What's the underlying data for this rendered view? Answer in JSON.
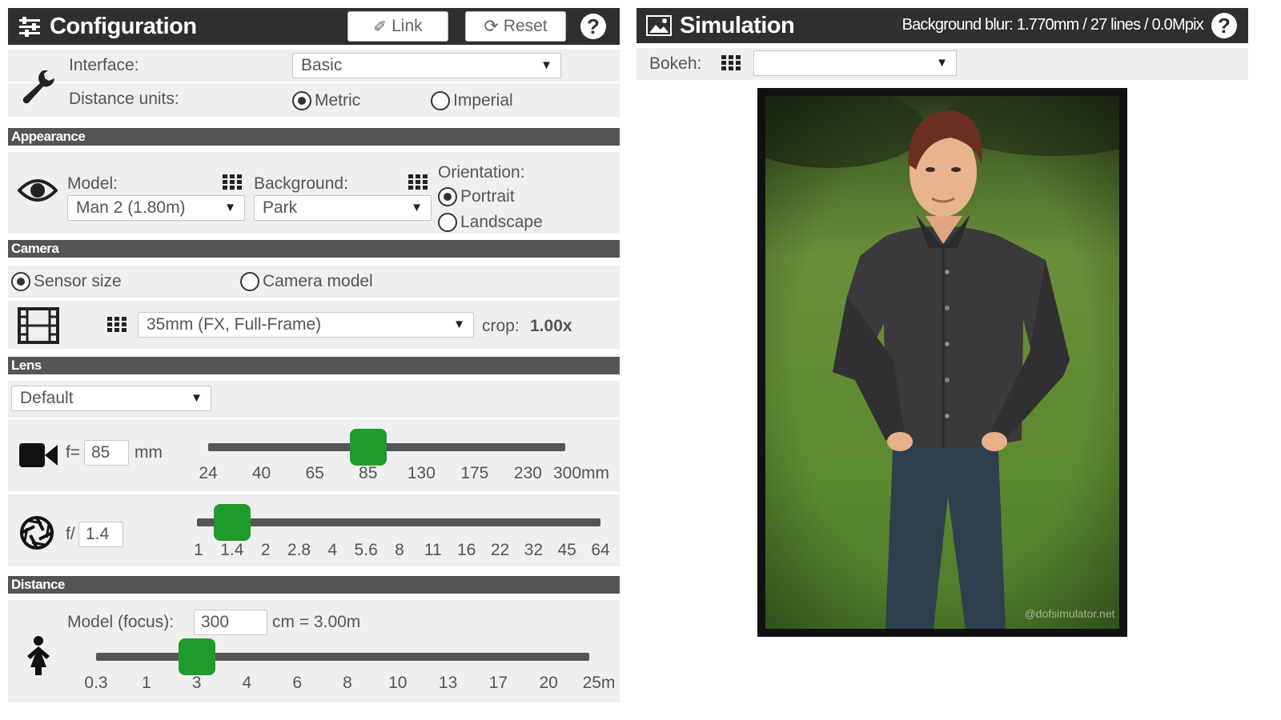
{
  "config": {
    "title": "Configuration",
    "link_label": "Link",
    "reset_label": "Reset",
    "help": "?",
    "interface_label": "Interface:",
    "interface_value": "Basic",
    "distance_units_label": "Distance units:",
    "units": [
      {
        "label": "Metric",
        "selected": true
      },
      {
        "label": "Imperial",
        "selected": false
      }
    ]
  },
  "appearance": {
    "heading": "Appearance",
    "model_label": "Model:",
    "model_value": "Man 2 (1.80m)",
    "background_label": "Background:",
    "background_value": "Park",
    "orientation_label": "Orientation:",
    "orientations": [
      {
        "label": "Portrait",
        "selected": true
      },
      {
        "label": "Landscape",
        "selected": false
      }
    ]
  },
  "camera": {
    "heading": "Camera",
    "modes": [
      {
        "label": "Sensor size",
        "selected": true
      },
      {
        "label": "Camera model",
        "selected": false
      }
    ],
    "sensor_value": "35mm (FX, Full-Frame)",
    "crop_label": "crop:",
    "crop_value": "1.00x"
  },
  "lens": {
    "heading": "Lens",
    "lens_value": "Default",
    "focal_prefix": "f=",
    "focal_value": "85",
    "focal_unit": "mm",
    "focal_ticks": [
      "24",
      "40",
      "65",
      "85",
      "130",
      "175",
      "230",
      "300mm"
    ],
    "focal_level_index": 3,
    "aperture_prefix": "f/",
    "aperture_value": "1.4",
    "aperture_ticks": [
      "1",
      "1.4",
      "2",
      "2.8",
      "4",
      "5.6",
      "8",
      "11",
      "16",
      "22",
      "32",
      "45",
      "64"
    ],
    "aperture_level_index": 1
  },
  "distance": {
    "heading": "Distance",
    "focus_label": "Model (focus):",
    "focus_value": "300",
    "focus_suffix": "cm = 3.00m",
    "ticks": [
      "0.3",
      "1",
      "3",
      "4",
      "6",
      "8",
      "10",
      "13",
      "17",
      "20",
      "25m"
    ],
    "level_index": 2
  },
  "simulation": {
    "title": "Simulation",
    "blur_info": "Background blur: 1.770mm / 27 lines / 0.0Mpix",
    "help": "?",
    "bokeh_label": "Bokeh:",
    "bokeh_value": "",
    "watermark": "@dofsimulator.net"
  },
  "colors": {
    "header": "#2f2f2f",
    "section": "#555555",
    "row": "#efefef",
    "slider_thumb": "#1f9b2c"
  }
}
